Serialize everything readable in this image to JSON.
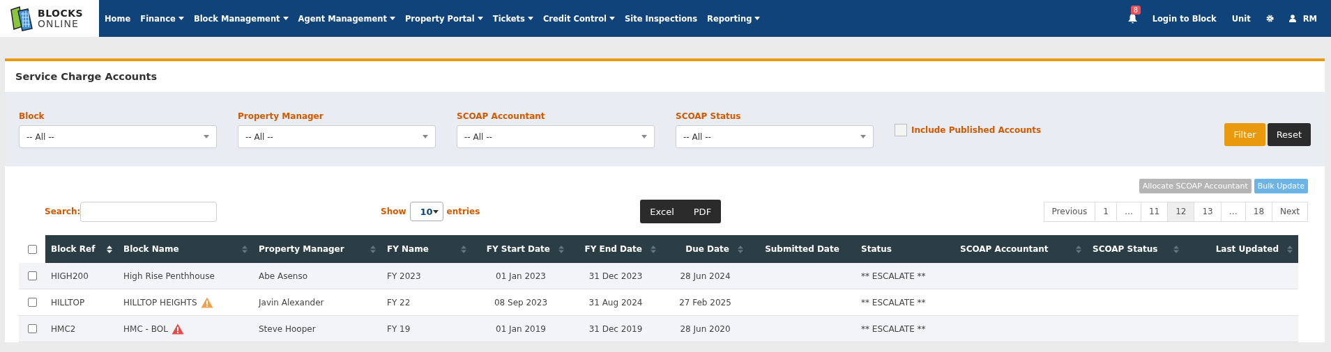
{
  "logo": {
    "line1": "BLOCKS",
    "line2": "ONLINE"
  },
  "nav": [
    {
      "label": "Home",
      "dropdown": false
    },
    {
      "label": "Finance",
      "dropdown": true
    },
    {
      "label": "Block Management",
      "dropdown": true
    },
    {
      "label": "Agent Management",
      "dropdown": true
    },
    {
      "label": "Property Portal",
      "dropdown": true
    },
    {
      "label": "Tickets",
      "dropdown": true
    },
    {
      "label": "Credit Control",
      "dropdown": true
    },
    {
      "label": "Site Inspections",
      "dropdown": false
    },
    {
      "label": "Reporting",
      "dropdown": true
    }
  ],
  "notifications": {
    "count": "8"
  },
  "nav_right": {
    "login": "Login to Block",
    "unit": "Unit",
    "user": "RM"
  },
  "page_title": "Service Charge Accounts",
  "filters": [
    {
      "label": "Block",
      "value": "-- All --"
    },
    {
      "label": "Property Manager",
      "value": "-- All --"
    },
    {
      "label": "SCOAP Accountant",
      "value": "-- All --"
    },
    {
      "label": "SCOAP Status",
      "value": "-- All --"
    }
  ],
  "include_published": {
    "label": "Include Published Accounts",
    "checked": false
  },
  "filter_buttons": {
    "filter": "Filter",
    "reset": "Reset"
  },
  "actions": [
    {
      "label": "Allocate SCOAP Accountant",
      "disabled": true
    },
    {
      "label": "Bulk Update",
      "disabled": false
    }
  ],
  "search": {
    "label": "Search:"
  },
  "length": {
    "show": "Show",
    "value": "10",
    "entries": "entries"
  },
  "export": [
    "Excel",
    "PDF"
  ],
  "pagination": [
    {
      "label": "Previous",
      "selected": false
    },
    {
      "label": "1",
      "selected": false
    },
    {
      "label": "…",
      "selected": false
    },
    {
      "label": "11",
      "selected": false
    },
    {
      "label": "12",
      "selected": true
    },
    {
      "label": "13",
      "selected": false
    },
    {
      "label": "…",
      "selected": false
    },
    {
      "label": "18",
      "selected": false
    },
    {
      "label": "Next",
      "selected": false
    }
  ],
  "table": {
    "select_all": false,
    "columns": [
      {
        "label": "Block Ref",
        "sortable": true,
        "sorted": true
      },
      {
        "label": "Block Name",
        "sortable": true,
        "sorted": false
      },
      {
        "label": "Property Manager",
        "sortable": true,
        "sorted": false
      },
      {
        "label": "FY Name",
        "sortable": true,
        "sorted": false
      },
      {
        "label": "FY Start Date",
        "sortable": true,
        "sorted": false
      },
      {
        "label": "FY End Date",
        "sortable": true,
        "sorted": false
      },
      {
        "label": "Due Date",
        "sortable": true,
        "sorted": false
      },
      {
        "label": "Submitted Date",
        "sortable": false
      },
      {
        "label": "Status",
        "sortable": false
      },
      {
        "label": "SCOAP Accountant",
        "sortable": true,
        "sorted": false
      },
      {
        "label": "SCOAP Status",
        "sortable": true,
        "sorted": false
      },
      {
        "label": "Last Updated",
        "sortable": true,
        "sorted": false
      }
    ],
    "rows": [
      {
        "checked": false,
        "cells": [
          "HIGH200",
          "High Rise Penthhouse",
          "Abe Asenso",
          "FY 2023",
          "01 Jan 2023",
          "31 Dec 2023",
          "28 Jun 2024",
          "",
          "** ESCALATE **",
          "",
          "",
          ""
        ]
      },
      {
        "checked": false,
        "icon": {
          "color": "#f0a04b"
        },
        "cells": [
          "HILLTOP",
          "HILLTOP HEIGHTS",
          "Javin Alexander",
          "FY 22",
          "08 Sep 2023",
          "31 Aug 2024",
          "27 Feb 2025",
          "",
          "** ESCALATE **",
          "",
          "",
          ""
        ]
      },
      {
        "checked": false,
        "icon": {
          "color": "#e64a4a"
        },
        "cells": [
          "HMC2",
          "HMC - BOL",
          "Steve Hooper",
          "FY 19",
          "01 Jan 2019",
          "31 Dec 2019",
          "28 Jun 2020",
          "",
          "** ESCALATE **",
          "",
          "",
          ""
        ]
      }
    ]
  }
}
